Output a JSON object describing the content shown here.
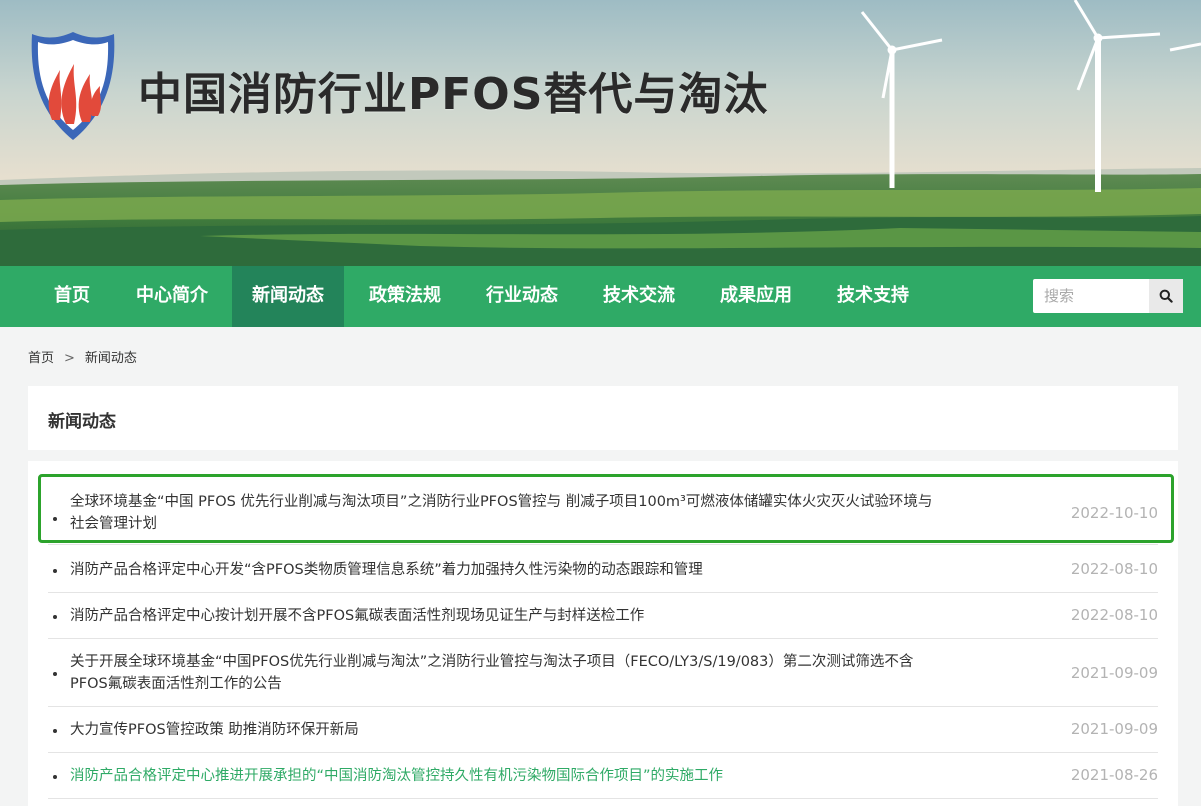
{
  "banner": {
    "site_title": "中国消防行业PFOS替代与淘汰"
  },
  "nav": {
    "items": [
      {
        "label": "首页"
      },
      {
        "label": "中心简介"
      },
      {
        "label": "新闻动态",
        "active": true
      },
      {
        "label": "政策法规"
      },
      {
        "label": "行业动态"
      },
      {
        "label": "技术交流"
      },
      {
        "label": "成果应用"
      },
      {
        "label": "技术支持"
      }
    ],
    "search": {
      "placeholder": "搜索",
      "icon": "search-icon"
    }
  },
  "breadcrumb": {
    "home": "首页",
    "separator": ">",
    "current": "新闻动态"
  },
  "section": {
    "title": "新闻动态"
  },
  "news": [
    {
      "title_line1": "全球环境基金“中国 PFOS 优先行业削减与淘汰项目”之消防行业PFOS管控与 削减子项目100m³可燃液体储罐实体火灾灭火试验环境与",
      "title_line2": "社会管理计划",
      "date": "2022-10-10",
      "focused": true
    },
    {
      "title_line1": "消防产品合格评定中心开发“含PFOS类物质管理信息系统”着力加强持久性污染物的动态跟踪和管理",
      "title_line2": "",
      "date": "2022-08-10"
    },
    {
      "title_line1": "消防产品合格评定中心按计划开展不含PFOS氟碳表面活性剂现场见证生产与封样送检工作",
      "title_line2": "",
      "date": "2022-08-10"
    },
    {
      "title_line1": "关于开展全球环境基金“中国PFOS优先行业削减与淘汰”之消防行业管控与淘汰子项目（FECO/LY3/S/19/083）第二次测试筛选不含",
      "title_line2": "PFOS氟碳表面活性剂工作的公告",
      "date": "2021-09-09"
    },
    {
      "title_line1": "大力宣传PFOS管控政策 助推消防环保开新局",
      "title_line2": "",
      "date": "2021-09-09"
    },
    {
      "title_line1": "消防产品合格评定中心推进开展承担的“中国消防淘汰管控持久性有机污染物国际合作项目”的实施工作",
      "title_line2": "",
      "date": "2021-08-26",
      "hover": true
    }
  ],
  "colors": {
    "nav_green": "#2faa66",
    "nav_active": "#23845a",
    "focus_ring": "#2ca32c",
    "date_gray": "#b3b3b3"
  }
}
